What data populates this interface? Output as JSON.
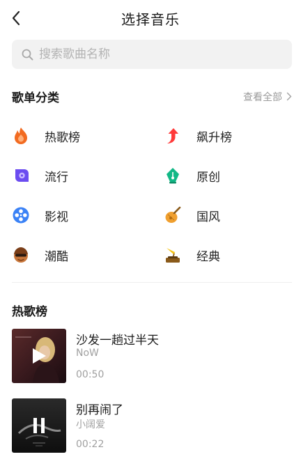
{
  "header": {
    "title": "选择音乐"
  },
  "search": {
    "placeholder": "搜索歌曲名称"
  },
  "categories": {
    "title": "歌单分类",
    "see_all": "查看全部",
    "items": [
      {
        "label": "热歌榜",
        "icon": "fire-icon"
      },
      {
        "label": "飙升榜",
        "icon": "rising-arrow-icon"
      },
      {
        "label": "流行",
        "icon": "pop-icon"
      },
      {
        "label": "原创",
        "icon": "pen-nib-icon"
      },
      {
        "label": "影视",
        "icon": "film-reel-icon"
      },
      {
        "label": "国风",
        "icon": "pipa-icon"
      },
      {
        "label": "潮酷",
        "icon": "cool-avatar-icon"
      },
      {
        "label": "经典",
        "icon": "gramophone-icon"
      }
    ]
  },
  "hot": {
    "title": "热歌榜",
    "songs": [
      {
        "title": "沙发一趟过半天",
        "artist": "NoW",
        "duration": "00:50",
        "state": "play"
      },
      {
        "title": "别再闹了",
        "artist": "小阔爱",
        "duration": "00:22",
        "state": "pause"
      }
    ]
  },
  "colors": {
    "accent_orange": "#f26b21",
    "rising_red": "#ff3a3a",
    "pop_purple": "#6b4cf0",
    "pen_green": "#12b886",
    "film_blue": "#3b82f6",
    "pipa_orange": "#f0a030",
    "muted_text": "#a0a0a0"
  }
}
